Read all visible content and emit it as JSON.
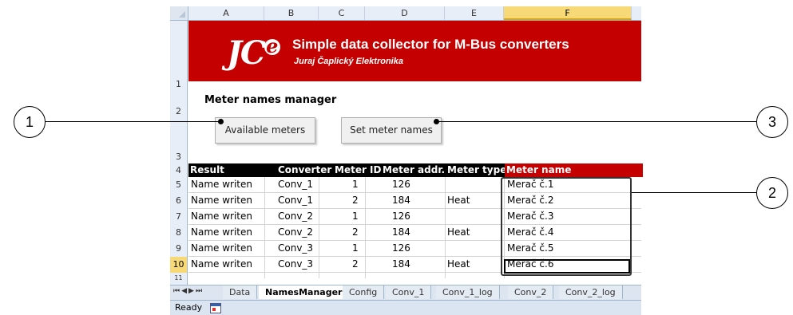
{
  "columns": [
    "A",
    "B",
    "C",
    "D",
    "E",
    "F"
  ],
  "rows": [
    "1",
    "2",
    "3",
    "4",
    "5",
    "6",
    "7",
    "8",
    "9",
    "10",
    "11"
  ],
  "banner": {
    "logo": "JC",
    "logo_e": "e",
    "title": "Simple data collector for M-Bus converters",
    "subtitle": "Juraj Čaplický Elektronika"
  },
  "section_title": "Meter names manager",
  "buttons": {
    "available_meters": "Available meters",
    "set_meter_names": "Set meter names"
  },
  "table": {
    "headers": [
      "Result",
      "Converter",
      "Meter ID",
      "Meter addr.",
      "Meter type",
      "Meter name"
    ],
    "rows": [
      [
        "Name writen",
        "Conv_1",
        "1",
        "126",
        "",
        "Merač č.1"
      ],
      [
        "Name writen",
        "Conv_1",
        "2",
        "184",
        "Heat",
        "Merač č.2"
      ],
      [
        "Name writen",
        "Conv_2",
        "1",
        "126",
        "",
        "Merač č.3"
      ],
      [
        "Name writen",
        "Conv_2",
        "2",
        "184",
        "Heat",
        "Merač č.4"
      ],
      [
        "Name writen",
        "Conv_3",
        "1",
        "126",
        "",
        "Merač č.5"
      ],
      [
        "Name writen",
        "Conv_3",
        "2",
        "184",
        "Heat",
        "Merač č.6"
      ]
    ]
  },
  "tabs": [
    "Data",
    "NamesManager",
    "Config",
    "Conv_1",
    "Conv_1_log",
    "Conv_2",
    "Conv_2_log"
  ],
  "active_tab": "NamesManager",
  "status": "Ready",
  "callouts": [
    "1",
    "2",
    "3"
  ],
  "colors": {
    "banner": "#c40000",
    "header_bg": "#000000",
    "selected_header": "#f7d977"
  }
}
